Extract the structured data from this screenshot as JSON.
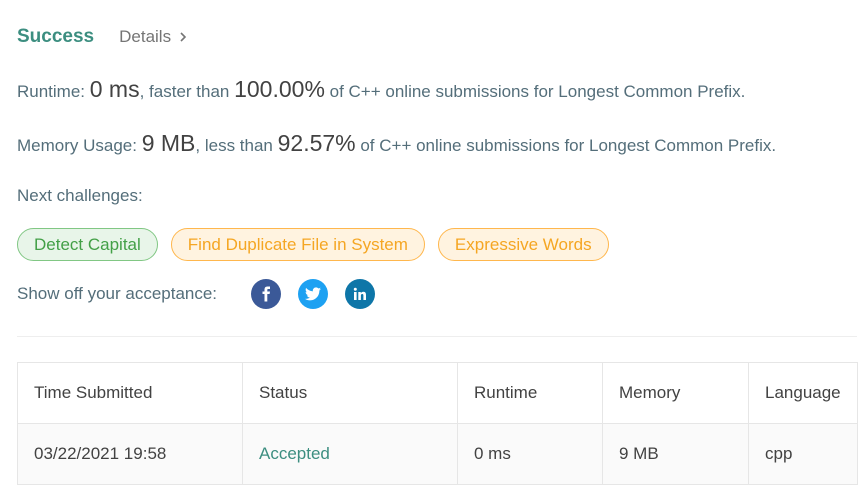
{
  "header": {
    "status": "Success",
    "details_label": "Details"
  },
  "runtime": {
    "label": "Runtime: ",
    "value": "0 ms",
    "mid": ", faster than ",
    "percent": "100.00%",
    "suffix": " of C++ online submissions for Longest Common Prefix."
  },
  "memory": {
    "label": "Memory Usage: ",
    "value": "9 MB",
    "mid": ", less than ",
    "percent": "92.57%",
    "suffix": " of C++ online submissions for Longest Common Prefix."
  },
  "next": {
    "label": "Next challenges:",
    "challenges": [
      {
        "name": "Detect Capital",
        "difficulty": "easy"
      },
      {
        "name": "Find Duplicate File in System",
        "difficulty": "medium"
      },
      {
        "name": "Expressive Words",
        "difficulty": "medium"
      }
    ]
  },
  "share": {
    "label": "Show off your acceptance:",
    "icons": [
      "facebook-icon",
      "twitter-icon",
      "linkedin-icon"
    ]
  },
  "table": {
    "headers": [
      "Time Submitted",
      "Status",
      "Runtime",
      "Memory",
      "Language"
    ],
    "rows": [
      {
        "time": "03/22/2021 19:58",
        "status": "Accepted",
        "runtime": "0 ms",
        "memory": "9 MB",
        "language": "cpp"
      }
    ]
  },
  "colors": {
    "success": "#3c8e80",
    "easy": "#43a047",
    "medium": "#f5a623",
    "facebook": "#3b5998",
    "twitter": "#1da1f2",
    "linkedin": "#0e76a8"
  }
}
